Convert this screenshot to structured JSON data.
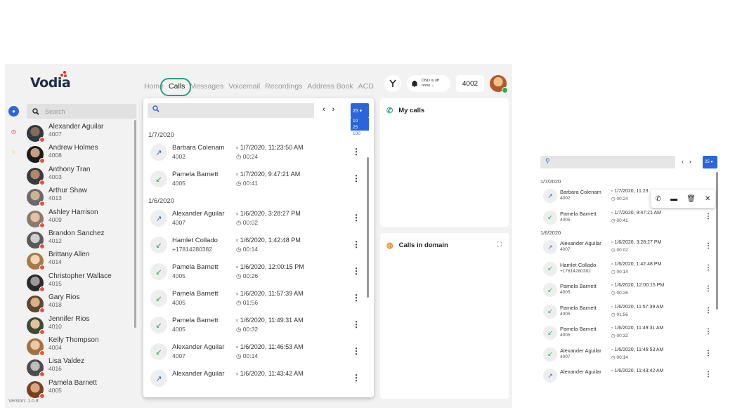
{
  "brand": {
    "name": "Vodia",
    "accent": "#2a66d9",
    "highlight": "#2a9d7f"
  },
  "nav": [
    {
      "label": "Home"
    },
    {
      "label": "Calls",
      "active": true
    },
    {
      "label": "Messages"
    },
    {
      "label": "Voicemail"
    },
    {
      "label": "Recordings"
    },
    {
      "label": "Address Book"
    },
    {
      "label": "ACD"
    }
  ],
  "header": {
    "dnd_line1": "DND is off",
    "dnd_line2": "none",
    "extension": "4002"
  },
  "sidebar": {
    "search_placeholder": "Search",
    "version": "Version: 1.0.8",
    "contacts": [
      {
        "name": "Alexander Aguilar",
        "ext": "4007"
      },
      {
        "name": "Andrew Holmes",
        "ext": "4008"
      },
      {
        "name": "Anthony Tran",
        "ext": "4003"
      },
      {
        "name": "Arthur Shaw",
        "ext": "4013"
      },
      {
        "name": "Ashley Harrison",
        "ext": "4009"
      },
      {
        "name": "Brandon Sanchez",
        "ext": "4012"
      },
      {
        "name": "Brittany Allen",
        "ext": "4014"
      },
      {
        "name": "Christopher Wallace",
        "ext": "4015"
      },
      {
        "name": "Gary Rios",
        "ext": "4018"
      },
      {
        "name": "Jennifer Rios",
        "ext": "4010"
      },
      {
        "name": "Kelly Thompson",
        "ext": "4004"
      },
      {
        "name": "Lisa Valdez",
        "ext": "4016"
      },
      {
        "name": "Pamela Barnett",
        "ext": "4005"
      }
    ]
  },
  "calls": {
    "per_page": "25",
    "per_page_options": [
      "10",
      "25",
      "100"
    ],
    "groups": [
      {
        "date": "1/7/2020",
        "rows": [
          {
            "name": "Barbara Colenam",
            "number": "4002",
            "time": "1/7/2020, 11:23:50 AM",
            "duration": "00:24",
            "dir": "out"
          },
          {
            "name": "Pamela Barnett",
            "number": "4005",
            "time": "1/7/2020, 9:47:21 AM",
            "duration": "00:41",
            "dir": "in"
          }
        ]
      },
      {
        "date": "1/6/2020",
        "rows": [
          {
            "name": "Alexander Aguilar",
            "number": "4007",
            "time": "1/6/2020, 3:28:27 PM",
            "duration": "00:02",
            "dir": "out"
          },
          {
            "name": "Hamlet Collado",
            "number": "+17814280382",
            "time": "1/6/2020, 1:42:48 PM",
            "duration": "00:14",
            "dir": "in"
          },
          {
            "name": "Pamela Barnett",
            "number": "4005",
            "time": "1/6/2020, 12:00:15 PM",
            "duration": "00:26",
            "dir": "in"
          },
          {
            "name": "Pamela Barnett",
            "number": "4005",
            "time": "1/6/2020, 11:57:39 AM",
            "duration": "01:56",
            "dir": "in"
          },
          {
            "name": "Pamela Barnett",
            "number": "4005",
            "time": "1/6/2020, 11:49:31 AM",
            "duration": "00:32",
            "dir": "in"
          },
          {
            "name": "Alexander Aguilar",
            "number": "4007",
            "time": "1/6/2020, 11:46:53 AM",
            "duration": "00:14",
            "dir": "in"
          },
          {
            "name": "Alexander Aguilar",
            "number": "",
            "time": "1/6/2020, 11:43:42 AM",
            "duration": "",
            "dir": "out"
          }
        ]
      }
    ]
  },
  "panels": {
    "my_calls": "My calls",
    "calls_in_domain": "Calls in domain"
  },
  "mini": {
    "per_page": "25",
    "first_time_truncated": "1/7/2020, 11:23"
  }
}
